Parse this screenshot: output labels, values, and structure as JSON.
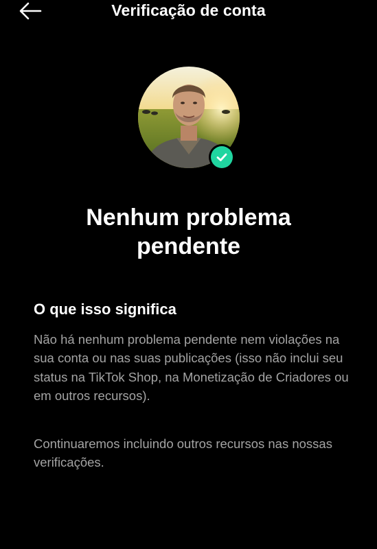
{
  "header": {
    "title": "Verificação de conta",
    "back_icon": "arrow-left-icon"
  },
  "profile": {
    "badge_icon": "check-icon",
    "badge_color": "#20d5a0"
  },
  "status": {
    "title_line1": "Nenhum problema",
    "title_line2": "pendente"
  },
  "info": {
    "heading": "O que isso significa",
    "paragraph1": "Não há nenhum problema pendente nem violações na sua conta ou nas suas publicações (isso não inclui seu status na TikTok Shop, na Monetização de Criadores ou em outros recursos).",
    "paragraph2": "Continuaremos incluindo outros recursos nas nossas verificações."
  },
  "colors": {
    "background": "#000000",
    "text_primary": "#ffffff",
    "text_secondary": "#a4a4a4",
    "accent": "#20d5a0"
  }
}
